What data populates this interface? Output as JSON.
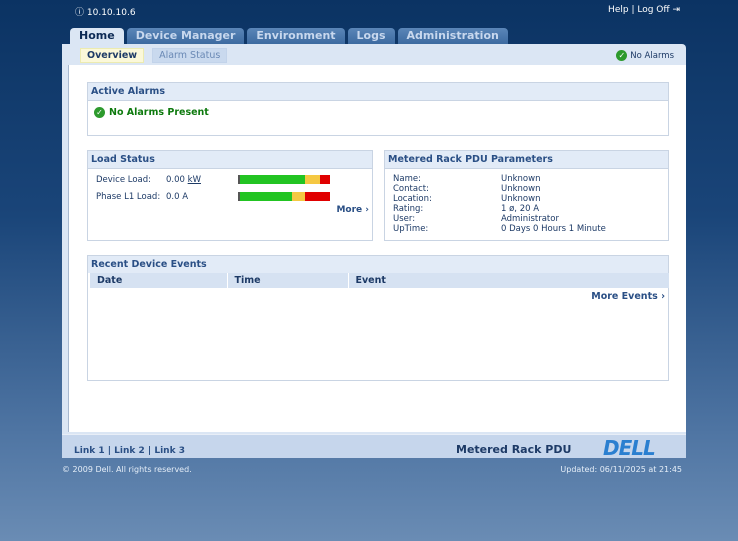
{
  "header": {
    "ip": "10.10.10.6",
    "help": "Help",
    "logoff": "Log Off"
  },
  "tabs": [
    "Home",
    "Device Manager",
    "Environment",
    "Logs",
    "Administration"
  ],
  "subtabs": [
    "Overview",
    "Alarm Status"
  ],
  "status": {
    "no_alarms": "No Alarms"
  },
  "active_alarms": {
    "title": "Active Alarms",
    "message": "No Alarms Present"
  },
  "load_status": {
    "title": "Load Status",
    "device_load_label": "Device Load:",
    "device_load_value": "0.00",
    "device_load_unit": "kW",
    "phase_label": "Phase L1 Load:",
    "phase_value": "0.0 A",
    "more": "More ›",
    "device_bar": {
      "green": 0.72,
      "yellow": 0.17,
      "red": 0.11
    },
    "phase_bar": {
      "green": 0.58,
      "yellow": 0.14,
      "red": 0.28
    },
    "colors": {
      "green": "#22c422",
      "yellow": "#f5c842",
      "red": "#e00000"
    }
  },
  "params": {
    "title": "Metered Rack PDU Parameters",
    "rows": [
      [
        "Name:",
        "Unknown"
      ],
      [
        "Contact:",
        "Unknown"
      ],
      [
        "Location:",
        "Unknown"
      ],
      [
        "Rating:",
        "1 ø, 20 A"
      ],
      [
        "User:",
        "Administrator"
      ],
      [
        "UpTime:",
        "0 Days 0 Hours 1 Minute"
      ]
    ]
  },
  "events": {
    "title": "Recent Device Events",
    "columns": [
      "Date",
      "Time",
      "Event"
    ],
    "more": "More Events ›"
  },
  "footer": {
    "links": [
      "Link 1",
      "Link 2",
      "Link 3"
    ],
    "product": "Metered Rack PDU",
    "logo": "DELL",
    "copyright": "© 2009 Dell. All rights reserved.",
    "updated": "Updated: 06/11/2025 at 21:45"
  }
}
